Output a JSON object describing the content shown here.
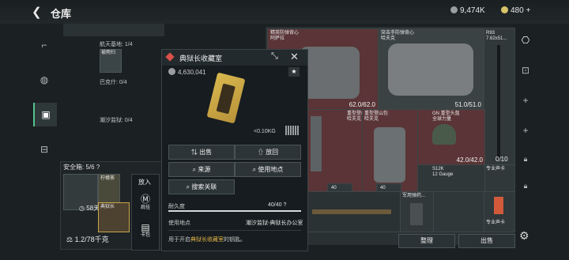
{
  "header": {
    "back_icon": "back-arrow-icon",
    "title": "仓库",
    "currency_silver": "9,474K",
    "currency_gold": "480"
  },
  "left_rail": {
    "items": [
      "pistol-icon",
      "grenade-icon",
      "vest-icon",
      "toolbox-icon"
    ]
  },
  "left_panel": {
    "sections": [
      {
        "label": "航天基地: 1/4"
      },
      {
        "label": "巴克什: 0/4"
      },
      {
        "label": "潮汐监狱: 0/4"
      }
    ],
    "small_item_label": "被雨扫",
    "safe_box": {
      "title": "安全箱: 5/6",
      "help": "?",
      "items": [
        {
          "label": ""
        },
        {
          "label": "柠檬茶"
        },
        {
          "label": "典狱长",
          "badge": "58天"
        }
      ]
    },
    "capacity": "1.2/78千克"
  },
  "put_in_menu": {
    "title": "放入",
    "options": [
      "肩挂",
      "卡包"
    ]
  },
  "modal": {
    "name": "典狱长收藏室",
    "value": "4,630,041",
    "weight": "<0.10KG",
    "buttons": {
      "sell": "出售",
      "putback": "放回",
      "source": "来源",
      "use_location": "使用地点",
      "search_related": "搜索关联"
    },
    "durability_label": "耐久度",
    "durability_value": "40/40",
    "durability_fraction": 1.0,
    "use_location_label": "使用地点",
    "use_location_value": "潮汐监狱-典狱长办公室",
    "description_prefix": "用于开启",
    "description_highlight": "典狱长收藏室",
    "description_suffix": "的钥匙。"
  },
  "inventory": {
    "armor1": {
      "name": "精英防弹背心\n阿萨拉",
      "durability": "62.0/62.0"
    },
    "armor2": {
      "name": "突击手防弹背心\n哈夫克",
      "durability": "51.0/51.0"
    },
    "gun1": {
      "name": "R93\n7.62x51..."
    },
    "vest1": {
      "name": "重型登山包\n哈夫克"
    },
    "vest2": {
      "name": "重型登山包\n哈夫克"
    },
    "helmet": {
      "name": "GN 重型头盔\n全球力量",
      "durability": "42.0/42.0"
    },
    "ammo": {
      "count": "0/10"
    },
    "shotgun": {
      "name": "S12K\n12 Gauge"
    },
    "count1": "40",
    "count2": "40",
    "item_bottom1": "军用弹药...",
    "item_pro": "专业声卡",
    "item_pro2": "专业声卡"
  },
  "right_rail": {
    "items": [
      "backpack-icon",
      "marker-icon",
      "plus-icon",
      "plus-icon",
      "lock-icon",
      "lock-icon"
    ]
  },
  "bottom": {
    "sort": "整理",
    "sell": "出售",
    "gear": "gear-icon"
  }
}
